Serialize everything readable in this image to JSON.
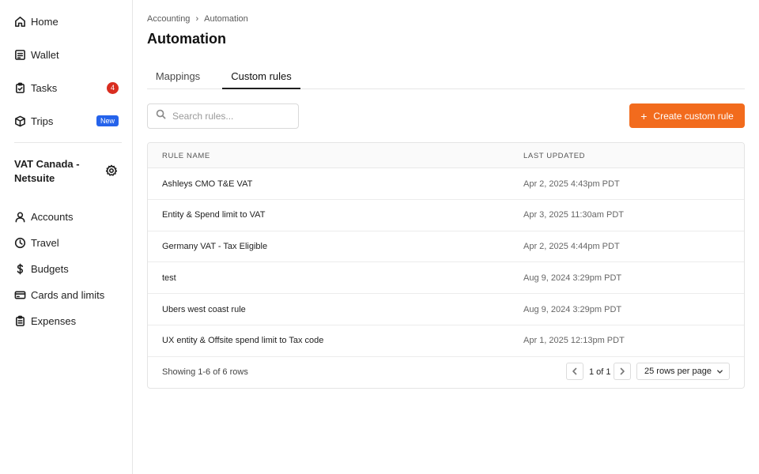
{
  "sidebar": {
    "items": [
      {
        "label": "Home",
        "icon": "home-icon"
      },
      {
        "label": "Wallet",
        "icon": "wallet-icon"
      },
      {
        "label": "Tasks",
        "icon": "clipboard-check-icon",
        "badge": "4"
      },
      {
        "label": "Trips",
        "icon": "box-icon",
        "tag": "New"
      }
    ],
    "entity_name": "VAT Canada - Netsuite",
    "entity_items": [
      {
        "label": "Accounts",
        "icon": "user-icon"
      },
      {
        "label": "Travel",
        "icon": "clock-icon"
      },
      {
        "label": "Budgets",
        "icon": "dollar-icon"
      },
      {
        "label": "Cards and limits",
        "icon": "credit-card-icon"
      },
      {
        "label": "Expenses",
        "icon": "clipboard-icon"
      }
    ]
  },
  "breadcrumb": {
    "parent": "Accounting",
    "current": "Automation"
  },
  "page_title": "Automation",
  "tabs": [
    {
      "label": "Mappings",
      "active": false
    },
    {
      "label": "Custom rules",
      "active": true
    }
  ],
  "search": {
    "placeholder": "Search rules...",
    "value": ""
  },
  "create_button": {
    "label": "Create custom rule"
  },
  "table": {
    "columns": [
      "RULE NAME",
      "LAST UPDATED"
    ],
    "rows": [
      {
        "name": "Ashleys CMO T&E VAT",
        "updated": "Apr 2, 2025 4:43pm PDT"
      },
      {
        "name": "Entity & Spend limit to VAT",
        "updated": "Apr 3, 2025 11:30am PDT"
      },
      {
        "name": "Germany VAT - Tax Eligible",
        "updated": "Apr 2, 2025 4:44pm PDT"
      },
      {
        "name": "test",
        "updated": "Aug 9, 2024 3:29pm PDT"
      },
      {
        "name": "Ubers west coast rule",
        "updated": "Aug 9, 2024 3:29pm PDT"
      },
      {
        "name": "UX entity & Offsite spend limit to Tax code",
        "updated": "Apr 1, 2025 12:13pm PDT"
      }
    ],
    "footer": {
      "showing": "Showing 1-6 of 6 rows",
      "page": "1 of 1",
      "rows_per_page": "25 rows per page"
    }
  },
  "colors": {
    "accent": "#f26b1d",
    "badge_red": "#d92d20",
    "tag_blue": "#2563eb"
  }
}
